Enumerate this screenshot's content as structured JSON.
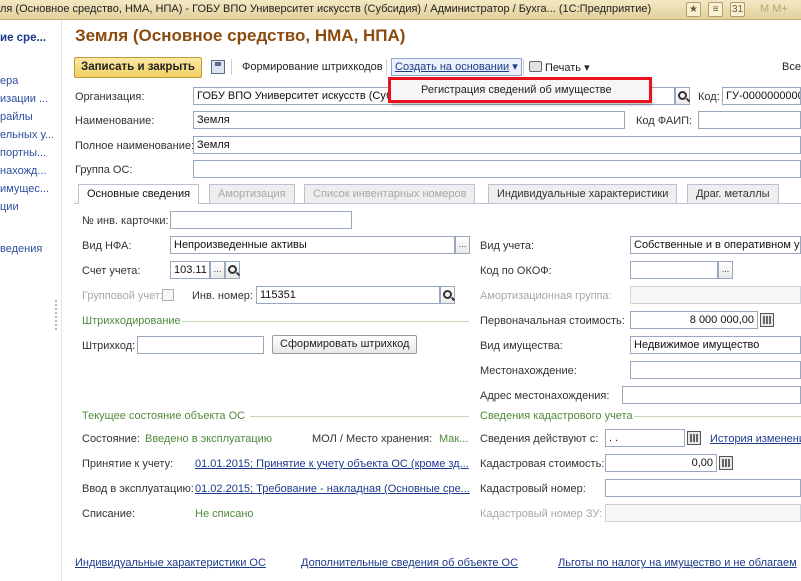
{
  "window": {
    "title": "ля (Основное средство, НМА, НПА) - ГОБУ ВПО Университет искусств (Субсидия) / Администратор / Бухга... (1С:Предприятие)",
    "right_letters": "M  M+",
    "calendar_label": "31"
  },
  "sidebar": {
    "header": "ие сре...",
    "items": [
      "ера",
      "изации ...",
      "райлы",
      "ельных у...",
      "портны...",
      "нахожд...",
      "имущес...",
      "ции"
    ],
    "footer_item": "ведения"
  },
  "form": {
    "title": "Земля (Основное средство, НМА, НПА)"
  },
  "toolbar": {
    "save_close": "Записать и закрыть",
    "barcodes": "Формирование штрихкодов",
    "create_based_on": "Создать на основании",
    "print": "Печать",
    "all_actions": "Все"
  },
  "dropdown": {
    "item": "Регистрация сведений об имуществе"
  },
  "header_fields": {
    "org_label": "Организация:",
    "org_value": "ГОБУ ВПО Университет искусств (Суб",
    "code_label": "Код:",
    "code_value": "ГУ-0000000000",
    "name_label": "Наименование:",
    "name_value": "Земля",
    "faip_label": "Код ФАИП:",
    "full_name_label": "Полное наименование:",
    "full_name_value": "Земля",
    "os_group_label": "Группа ОС:"
  },
  "tabs": [
    "Основные сведения",
    "Амортизация",
    "Список инвентарных номеров",
    "Индивидуальные характеристики",
    "Драг. металлы"
  ],
  "main": {
    "inv_card_label": "№ инв. карточки:",
    "nfa_type_label": "Вид НФА:",
    "nfa_type_value": "Непроизведенные активы",
    "account_label": "Счет учета:",
    "account_value": "103.11",
    "group_account_label": "Групповой учет:",
    "inv_number_label": "Инв. номер:",
    "inv_number_value": "115351",
    "barcoding_section": "Штрихкодирование",
    "barcode_label": "Штрихкод:",
    "gen_barcode_button": "Сформировать штрихкод",
    "accounting_type_label": "Вид учета:",
    "accounting_type_value": "Собственные и в оперативном уп",
    "okof_label": "Код по ОКОФ:",
    "amort_group_label": "Амортизационная группа:",
    "initial_cost_label": "Первоначальная стоимость:",
    "initial_cost_value": "8 000 000,00",
    "property_type_label": "Вид имущества:",
    "property_type_value": "Недвижимое имущество",
    "location_label": "Местонахождение:",
    "location_address_label": "Адрес местонахождения:",
    "current_state_section": "Текущее состояние объекта ОС",
    "state_label": "Состояние:",
    "state_value": "Введено в эксплуатацию",
    "mol_label": "МОЛ / Место хранения:",
    "mol_value": "Мак...",
    "acceptance_label": "Принятие к учету:",
    "acceptance_value": "01.01.2015; Принятие к учету объекта ОС (кроме зд...",
    "commissioning_label": "Ввод в эксплуатацию:",
    "commissioning_value": "01.02.2015; Требование - накладная (Основные сре...",
    "writeoff_label": "Списание:",
    "writeoff_value": "Не списано",
    "cadastral_section": "Сведения кадастрового учета",
    "valid_from_label": "Сведения действуют с:",
    "valid_from_value": " .  .",
    "history_link": "История изменени",
    "cadastral_value_label": "Кадастровая стоимость:",
    "cadastral_value_value": "0,00",
    "cadastral_number_label": "Кадастровый номер:",
    "cadastral_zu_label": "Кадастровый номер ЗУ:"
  },
  "footer": {
    "link1": "Индивидуальные характеристики ОС",
    "link2": "Дополнительные сведения об объекте ОС",
    "link3": "Льготы по налогу на имущество и не облагаем"
  },
  "colors": {
    "title_brown": "#8b4a0e",
    "link_blue": "#1c3b8a",
    "section_green": "#4e8a3c",
    "highlight_red": "#e8141d"
  }
}
